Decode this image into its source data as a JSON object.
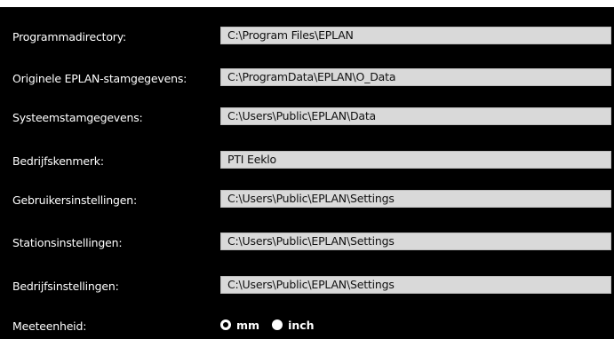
{
  "settings": [
    {
      "label": "Programmadirectory:",
      "value": "C:\\Program Files\\EPLAN"
    },
    {
      "label": "Originele EPLAN-stamgegevens:",
      "value": "C:\\ProgramData\\EPLAN\\O_Data"
    },
    {
      "label": "Systeemstamgegevens:",
      "value": "C:\\Users\\Public\\EPLAN\\Data"
    },
    {
      "label": "Bedrijfskenmerk:",
      "value": "PTI Eeklo"
    },
    {
      "label": "Gebruikersinstellingen:",
      "value": "C:\\Users\\Public\\EPLAN\\Settings"
    },
    {
      "label": "Stationsinstellingen:",
      "value": "C:\\Users\\Public\\EPLAN\\Settings"
    },
    {
      "label": "Bedrijfsinstellingen:",
      "value": "C:\\Users\\Public\\EPLAN\\Settings"
    }
  ],
  "units": {
    "label": "Meeteenheid:",
    "options": [
      {
        "label": "mm",
        "checked": true
      },
      {
        "label": "inch",
        "checked": false
      }
    ]
  },
  "colors": {
    "background": "#000000",
    "field": "#d9d9d9",
    "text": "#ffffff"
  }
}
